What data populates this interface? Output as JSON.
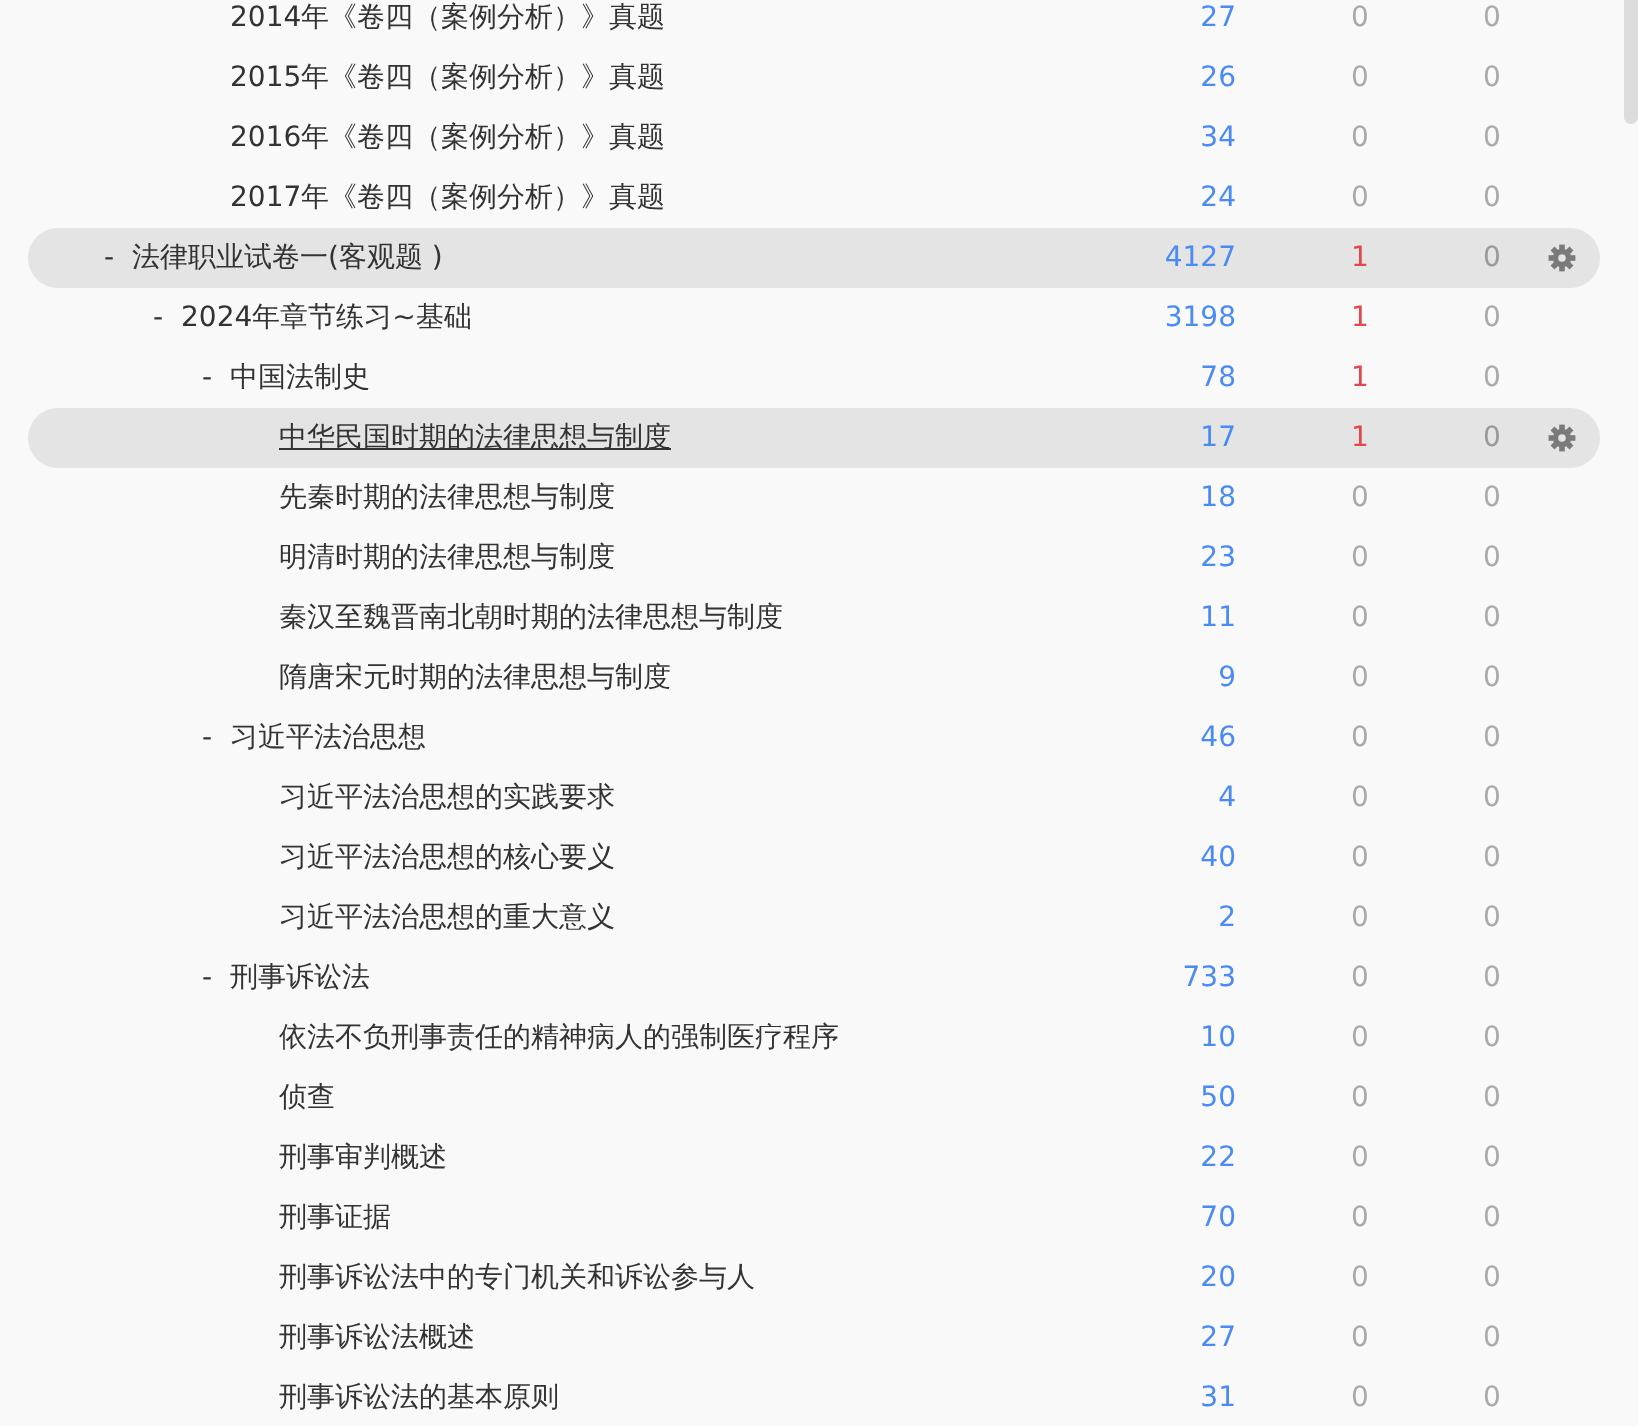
{
  "tree": {
    "continued_children": [
      {
        "label": "2014年《卷四（案例分析）》真题",
        "count": "27",
        "column_3": "0",
        "column_3_highlighted": false,
        "column_4": "0",
        "hovered": false,
        "underlined": false
      },
      {
        "label": "2015年《卷四（案例分析）》真题",
        "count": "26",
        "column_3": "0",
        "column_3_highlighted": false,
        "column_4": "0",
        "hovered": false,
        "underlined": false
      },
      {
        "label": "2016年《卷四（案例分析）》真题",
        "count": "34",
        "column_3": "0",
        "column_3_highlighted": false,
        "column_4": "0",
        "hovered": false,
        "underlined": false
      },
      {
        "label": "2017年《卷四（案例分析）》真题",
        "count": "24",
        "column_3": "0",
        "column_3_highlighted": false,
        "column_4": "0",
        "hovered": false,
        "underlined": false
      }
    ],
    "nodes": [
      {
        "toggle": "-",
        "label": "法律职业试卷一(客观题 )",
        "count": "4127",
        "column_3": "1",
        "column_3_highlighted": true,
        "column_4": "0",
        "hovered": true,
        "underlined": false,
        "children": [
          {
            "toggle": "-",
            "label": "2024年章节练习~基础",
            "count": "3198",
            "column_3": "1",
            "column_3_highlighted": true,
            "column_4": "0",
            "hovered": false,
            "underlined": false,
            "children": [
              {
                "toggle": "-",
                "label": "中国法制史",
                "count": "78",
                "column_3": "1",
                "column_3_highlighted": true,
                "column_4": "0",
                "hovered": false,
                "underlined": false,
                "children": [
                  {
                    "label": "中华民国时期的法律思想与制度",
                    "count": "17",
                    "column_3": "1",
                    "column_3_highlighted": true,
                    "column_4": "0",
                    "hovered": true,
                    "underlined": true
                  },
                  {
                    "label": "先秦时期的法律思想与制度",
                    "count": "18",
                    "column_3": "0",
                    "column_3_highlighted": false,
                    "column_4": "0",
                    "hovered": false,
                    "underlined": false
                  },
                  {
                    "label": "明清时期的法律思想与制度",
                    "count": "23",
                    "column_3": "0",
                    "column_3_highlighted": false,
                    "column_4": "0",
                    "hovered": false,
                    "underlined": false
                  },
                  {
                    "label": "秦汉至魏晋南北朝时期的法律思想与制度",
                    "count": "11",
                    "column_3": "0",
                    "column_3_highlighted": false,
                    "column_4": "0",
                    "hovered": false,
                    "underlined": false
                  },
                  {
                    "label": "隋唐宋元时期的法律思想与制度",
                    "count": "9",
                    "column_3": "0",
                    "column_3_highlighted": false,
                    "column_4": "0",
                    "hovered": false,
                    "underlined": false
                  }
                ]
              },
              {
                "toggle": "-",
                "label": "习近平法治思想",
                "count": "46",
                "column_3": "0",
                "column_3_highlighted": false,
                "column_4": "0",
                "hovered": false,
                "underlined": false,
                "children": [
                  {
                    "label": "习近平法治思想的实践要求",
                    "count": "4",
                    "column_3": "0",
                    "column_3_highlighted": false,
                    "column_4": "0",
                    "hovered": false,
                    "underlined": false
                  },
                  {
                    "label": "习近平法治思想的核心要义",
                    "count": "40",
                    "column_3": "0",
                    "column_3_highlighted": false,
                    "column_4": "0",
                    "hovered": false,
                    "underlined": false
                  },
                  {
                    "label": "习近平法治思想的重大意义",
                    "count": "2",
                    "column_3": "0",
                    "column_3_highlighted": false,
                    "column_4": "0",
                    "hovered": false,
                    "underlined": false
                  }
                ]
              },
              {
                "toggle": "-",
                "label": "刑事诉讼法",
                "count": "733",
                "column_3": "0",
                "column_3_highlighted": false,
                "column_4": "0",
                "hovered": false,
                "underlined": false,
                "children": [
                  {
                    "label": "依法不负刑事责任的精神病人的强制医疗程序",
                    "count": "10",
                    "column_3": "0",
                    "column_3_highlighted": false,
                    "column_4": "0",
                    "hovered": false,
                    "underlined": false
                  },
                  {
                    "label": "侦查",
                    "count": "50",
                    "column_3": "0",
                    "column_3_highlighted": false,
                    "column_4": "0",
                    "hovered": false,
                    "underlined": false
                  },
                  {
                    "label": "刑事审判概述",
                    "count": "22",
                    "column_3": "0",
                    "column_3_highlighted": false,
                    "column_4": "0",
                    "hovered": false,
                    "underlined": false
                  },
                  {
                    "label": "刑事证据",
                    "count": "70",
                    "column_3": "0",
                    "column_3_highlighted": false,
                    "column_4": "0",
                    "hovered": false,
                    "underlined": false
                  },
                  {
                    "label": "刑事诉讼法中的专门机关和诉讼参与人",
                    "count": "20",
                    "column_3": "0",
                    "column_3_highlighted": false,
                    "column_4": "0",
                    "hovered": false,
                    "underlined": false
                  },
                  {
                    "label": "刑事诉讼法概述",
                    "count": "27",
                    "column_3": "0",
                    "column_3_highlighted": false,
                    "column_4": "0",
                    "hovered": false,
                    "underlined": false
                  },
                  {
                    "label": "刑事诉讼法的基本原则",
                    "count": "31",
                    "column_3": "0",
                    "column_3_highlighted": false,
                    "column_4": "0",
                    "hovered": false,
                    "underlined": false
                  }
                ]
              }
            ]
          }
        ]
      }
    ]
  }
}
